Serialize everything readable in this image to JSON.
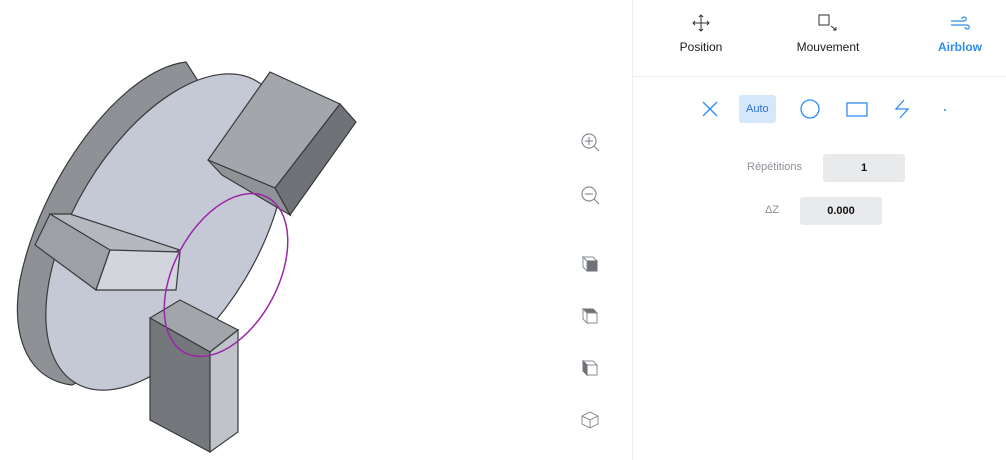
{
  "tabs": [
    {
      "label": "Position",
      "icon": "move-arrows-icon"
    },
    {
      "label": "Mouvement",
      "icon": "movement-square-icon"
    },
    {
      "label": "Airblow",
      "icon": "airblow-wind-icon",
      "active": true
    }
  ],
  "tools": {
    "auto_label": "Auto",
    "active_color": "#2f8cf0"
  },
  "fields": {
    "repetitions_label": "Répétitions",
    "repetitions_value": "1",
    "delta_z_label": "ΔZ",
    "delta_z_value": "0.000"
  },
  "view_tools": [
    "zoom-in-icon",
    "zoom-out-icon",
    "view-cube-front-icon",
    "view-cube-top-icon",
    "view-cube-side-icon",
    "view-cube-iso-icon"
  ],
  "colors": {
    "accent": "#2f8cf0",
    "path": "#9b27a8"
  }
}
